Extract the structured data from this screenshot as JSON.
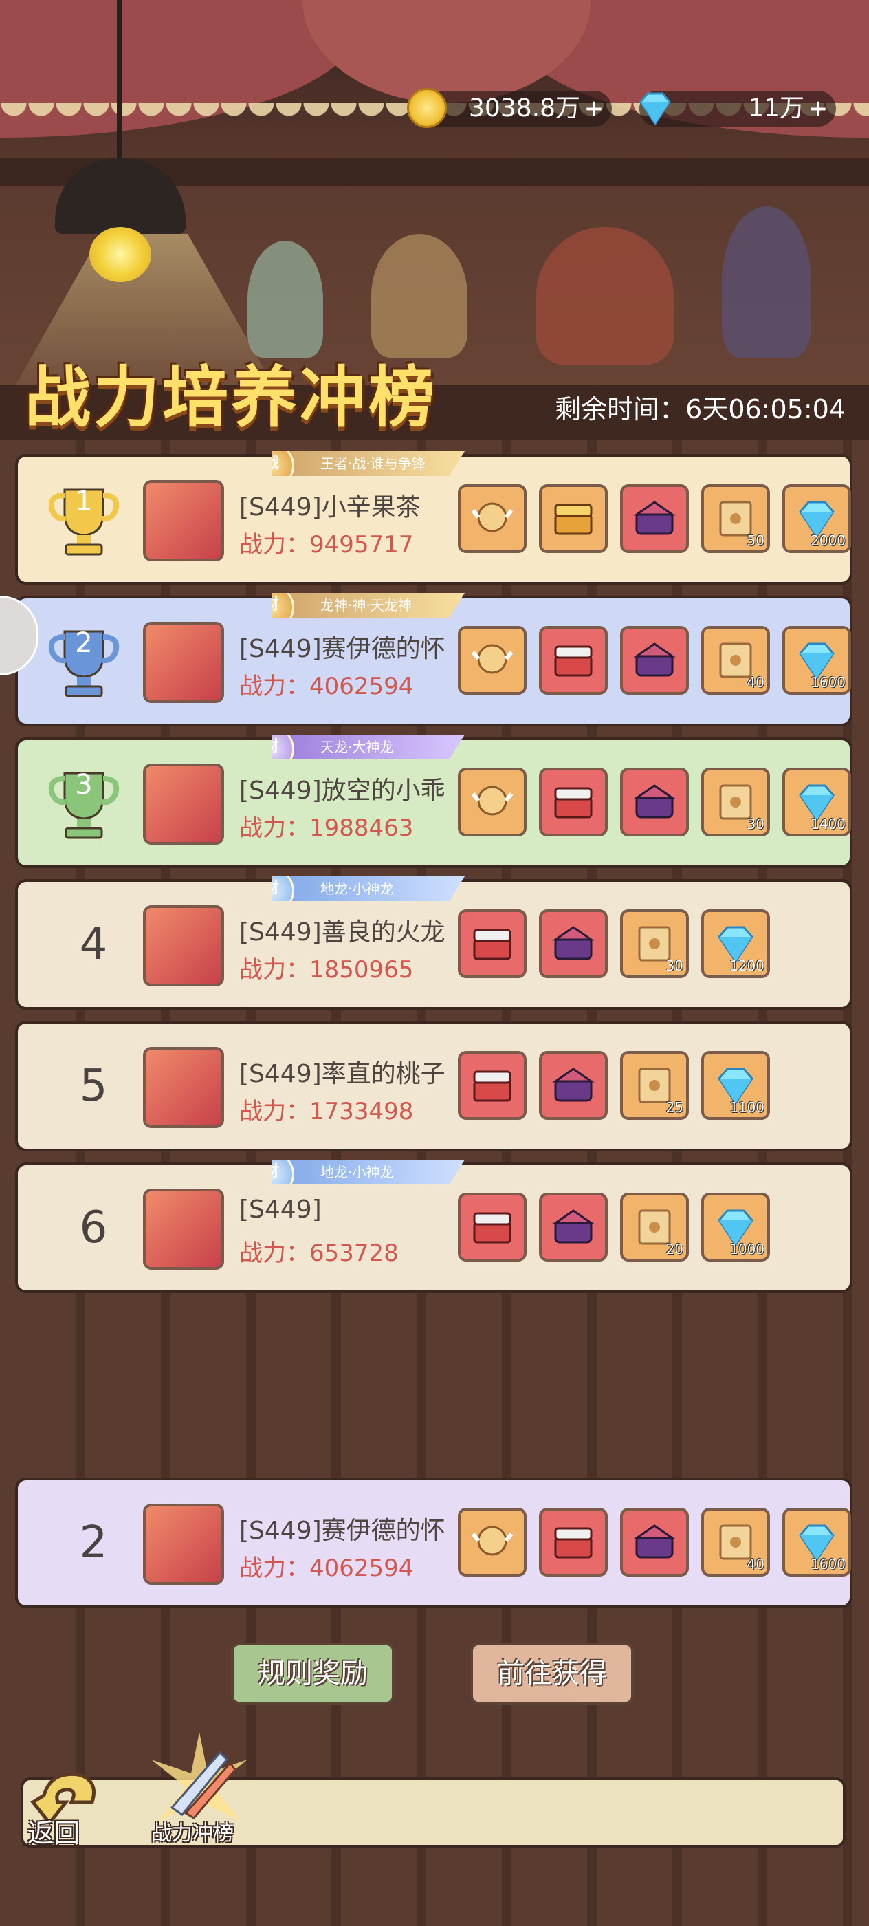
{
  "header": {
    "gold": "3038.8万",
    "gems": "11万",
    "title": "战力培养冲榜",
    "timer_label": "剩余时间：",
    "timer_value": "6天06:05:04"
  },
  "power_label": "战力：",
  "rows": [
    {
      "rank": "1",
      "name": "[S449]小辛果茶",
      "power": "9495717",
      "badge": "战",
      "banner": "王者·战·谁与争锋",
      "rewards": [
        {
          "type": "badge-ticket",
          "count": ""
        },
        {
          "type": "gold-chest",
          "count": ""
        },
        {
          "type": "dragon-box",
          "count": ""
        },
        {
          "type": "scroll",
          "count": "50"
        },
        {
          "type": "gem",
          "count": "2000"
        }
      ]
    },
    {
      "rank": "2",
      "name": "[S449]赛伊德的怀",
      "power": "4062594",
      "badge": "财",
      "banner": "龙神·神·天龙神",
      "rewards": [
        {
          "type": "badge-ticket",
          "count": ""
        },
        {
          "type": "red-chest",
          "count": ""
        },
        {
          "type": "dragon-box",
          "count": ""
        },
        {
          "type": "scroll",
          "count": "40"
        },
        {
          "type": "gem",
          "count": "1600"
        }
      ]
    },
    {
      "rank": "3",
      "name": "[S449]放空的小乖",
      "power": "1988463",
      "badge": "财",
      "banner": "天龙·大神龙",
      "rewards": [
        {
          "type": "badge-ticket",
          "count": ""
        },
        {
          "type": "red-chest",
          "count": ""
        },
        {
          "type": "dragon-box",
          "count": ""
        },
        {
          "type": "scroll",
          "count": "30"
        },
        {
          "type": "gem",
          "count": "1400"
        }
      ]
    },
    {
      "rank": "4",
      "name": "[S449]善良的火龙",
      "power": "1850965",
      "badge": "财",
      "banner": "地龙·小神龙",
      "rewards": [
        {
          "type": "red-chest",
          "count": ""
        },
        {
          "type": "dragon-box",
          "count": ""
        },
        {
          "type": "scroll",
          "count": "30"
        },
        {
          "type": "gem",
          "count": "1200"
        }
      ]
    },
    {
      "rank": "5",
      "name": "[S449]率直的桃子",
      "power": "1733498",
      "badge": "",
      "banner": "",
      "rewards": [
        {
          "type": "red-chest",
          "count": ""
        },
        {
          "type": "dragon-box",
          "count": ""
        },
        {
          "type": "scroll",
          "count": "25"
        },
        {
          "type": "gem",
          "count": "1100"
        }
      ]
    },
    {
      "rank": "6",
      "name": "[S449]",
      "power": "653728",
      "badge": "财",
      "banner": "地龙·小神龙",
      "rewards": [
        {
          "type": "red-chest",
          "count": ""
        },
        {
          "type": "dragon-box",
          "count": ""
        },
        {
          "type": "scroll",
          "count": "20"
        },
        {
          "type": "gem",
          "count": "1000"
        }
      ]
    }
  ],
  "my_row": {
    "rank": "2",
    "name": "[S449]赛伊德的怀",
    "power": "4062594",
    "rewards": [
      {
        "type": "badge-ticket",
        "count": ""
      },
      {
        "type": "red-chest",
        "count": ""
      },
      {
        "type": "dragon-box",
        "count": ""
      },
      {
        "type": "scroll",
        "count": "40"
      },
      {
        "type": "gem",
        "count": "1600"
      }
    ]
  },
  "buttons": {
    "rules": "规则奖励",
    "go": "前往获得"
  },
  "bottom": {
    "back": "返回",
    "tab": "战力冲榜"
  },
  "colors": {
    "gold_row": "#f7e9c8",
    "silver_row": "#cfd8f4",
    "bronze_row": "#d6ebc3",
    "plain_row": "#f1e6d1",
    "my_row": "#e6dcf6",
    "power_text": "#d2584f"
  }
}
